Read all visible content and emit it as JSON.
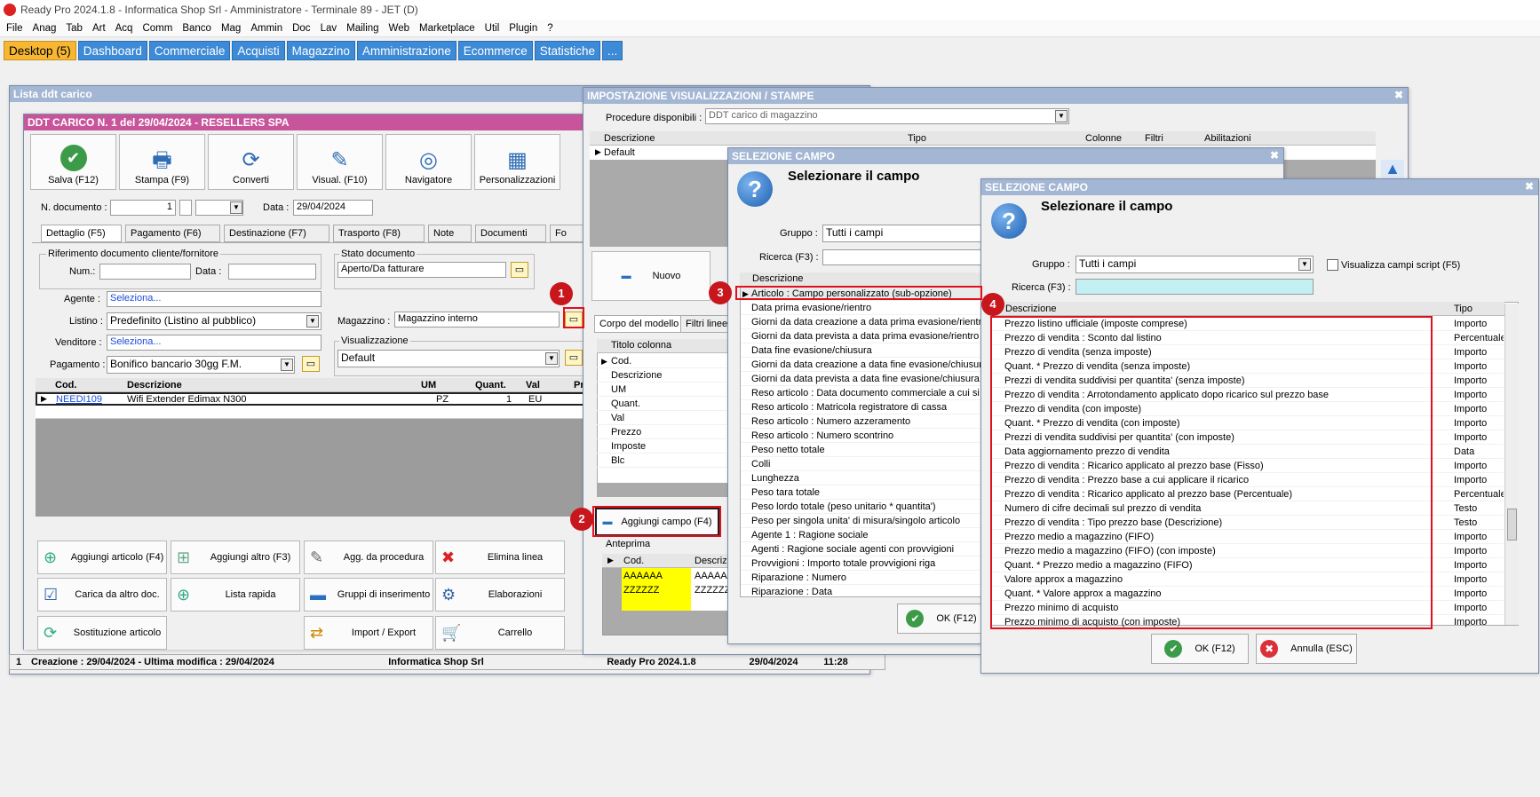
{
  "app": {
    "title": "Ready Pro 2024.1.8 - Informatica Shop Srl - Amministratore - Terminale 89 - JET (D)"
  },
  "menu": [
    "File",
    "Anag",
    "Tab",
    "Art",
    "Acq",
    "Comm",
    "Banco",
    "Mag",
    "Ammin",
    "Doc",
    "Lav",
    "Mailing",
    "Web",
    "Marketplace",
    "Util",
    "Plugin",
    "?"
  ],
  "tabs": [
    "Desktop (5)",
    "Dashboard",
    "Commerciale",
    "Acquisti",
    "Magazzino",
    "Amministrazione",
    "Ecommerce",
    "Statistiche",
    "..."
  ],
  "list_win": {
    "title": "Lista ddt carico"
  },
  "ddt": {
    "title": "DDT CARICO N. 1 del 29/04/2024 - RESELLERS SPA",
    "toolbar": [
      "Salva (F12)",
      "Stampa (F9)",
      "Converti",
      "Visual. (F10)",
      "Navigatore",
      "Personalizzazioni"
    ],
    "ndoc_label": "N. documento :",
    "ndoc": "1",
    "data_label": "Data :",
    "data": "29/04/2024",
    "subtabs": [
      "Dettaglio (F5)",
      "Pagamento (F6)",
      "Destinazione (F7)",
      "Trasporto (F8)",
      "Note",
      "Documenti",
      "Fo"
    ],
    "rif_title": "Riferimento documento cliente/fornitore",
    "num_label": "Num.:",
    "data2_label": "Data :",
    "stato_title": "Stato documento",
    "stato": "Aperto/Da fatturare",
    "agente_label": "Agente :",
    "agente": "Seleziona...",
    "listino_label": "Listino :",
    "listino": "Predefinito (Listino al pubblico)",
    "venditore_label": "Venditore :",
    "venditore": "Seleziona...",
    "pagamento_label": "Pagamento :",
    "pagamento": "Bonifico bancario 30gg F.M.",
    "magazzino_label": "Magazzino :",
    "magazzino": "Magazzino interno",
    "vis_title": "Visualizzazione",
    "vis": "Default",
    "cols": [
      "Cod.",
      "Descrizione",
      "UM",
      "Quant.",
      "Val",
      "Pr"
    ],
    "row": {
      "cod": "NEEDI109",
      "desc": "Wifi Extender Edimax N300",
      "um": "PZ",
      "qty": "1",
      "val": "EU"
    },
    "actions": [
      "Aggiungi articolo (F4)",
      "Aggiungi altro (F3)",
      "Agg. da procedura",
      "Elimina linea",
      "Carica da altro doc.",
      "Lista rapida",
      "Gruppi di inserimento",
      "Elaborazioni",
      "Sostituzione articolo",
      "Import / Export",
      "Carrello"
    ],
    "status": {
      "creazione": "Creazione : 29/04/2024 - Ultima modifica : 29/04/2024",
      "company": "Informatica Shop Srl",
      "version": "Ready Pro 2024.1.8",
      "date": "29/04/2024",
      "time": "11:28"
    }
  },
  "imp": {
    "title": "IMPOSTAZIONE VISUALIZZAZIONI / STAMPE",
    "proc_label": "Procedure disponibili :",
    "proc": "DDT carico di magazzino",
    "cols": [
      "Descrizione",
      "Tipo",
      "Colonne",
      "Filtri",
      "Abilitazioni"
    ],
    "row": "Default",
    "nuovo": "Nuovo",
    "subtabs": [
      "Corpo del modello",
      "Filtri linee"
    ],
    "col_head": "Titolo colonna",
    "col_items": [
      "Cod.",
      "Descrizione",
      "UM",
      "Quant.",
      "Val",
      "Prezzo",
      "Imposte",
      "Blc"
    ],
    "aggiungi": "Aggiungi campo (F4)",
    "anteprima": "Anteprima",
    "prev_cols": [
      "Cod.",
      "Descrizi"
    ],
    "prev_rows": [
      [
        "AAAAAA",
        "AAAAAA"
      ],
      [
        "ZZZZZZ",
        "ZZZZZZ"
      ]
    ]
  },
  "sel1": {
    "title": "SELEZIONE CAMPO",
    "heading": "Selezionare il campo",
    "gruppo_label": "Gruppo :",
    "gruppo": "Tutti i campi",
    "ricerca_label": "Ricerca (F3) :",
    "col": "Descrizione",
    "items": [
      "Articolo : Campo personalizzato (sub-opzione)",
      "Data prima evasione/rientro",
      "Giorni da data creazione a data prima evasione/rientro",
      "Giorni da data prevista a data prima evasione/rientro",
      "Data fine evasione/chiusura",
      "Giorni da data creazione a data fine evasione/chiusura",
      "Giorni da data prevista a data fine evasione/chiusura",
      "Reso articolo : Data documento commerciale a cui si ri",
      "Reso articolo : Matricola registratore di cassa",
      "Reso articolo : Numero azzeramento",
      "Reso articolo : Numero scontrino",
      "Peso netto totale",
      "Colli",
      "Lunghezza",
      "Peso tara totale",
      "Peso lordo totale (peso unitario * quantita')",
      "Peso per singola unita' di misura/singolo articolo",
      "Agente 1 : Ragione sociale",
      "Agenti : Ragione sociale agenti con provvigioni",
      "Provvigioni : Importo totale provvigioni riga",
      "Riparazione : Numero",
      "Riparazione : Data"
    ],
    "ok": "OK (F12)"
  },
  "sel2": {
    "title": "SELEZIONE CAMPO",
    "heading": "Selezionare il campo",
    "gruppo_label": "Gruppo :",
    "gruppo": "Tutti i campi",
    "script_label": "Visualizza campi script (F5)",
    "ricerca_label": "Ricerca (F3) :",
    "ricerca": "",
    "cols": [
      "Descrizione",
      "Tipo"
    ],
    "rows": [
      [
        "Prezzo listino ufficiale (imposte comprese)",
        "Importo"
      ],
      [
        "Prezzo di vendita : Sconto dal listino",
        "Percentuale"
      ],
      [
        "Prezzo di vendita (senza imposte)",
        "Importo"
      ],
      [
        "Quant. * Prezzo di vendita (senza imposte)",
        "Importo"
      ],
      [
        "Prezzi di vendita suddivisi per quantita' (senza imposte)",
        "Importo"
      ],
      [
        "Prezzo di vendita : Arrotondamento applicato dopo ricarico sul prezzo base",
        "Importo"
      ],
      [
        "Prezzo di vendita (con imposte)",
        "Importo"
      ],
      [
        "Quant. * Prezzo di vendita (con imposte)",
        "Importo"
      ],
      [
        "Prezzi di vendita suddivisi per quantita' (con imposte)",
        "Importo"
      ],
      [
        "Data aggiornamento prezzo di vendita",
        "Data"
      ],
      [
        "Prezzo di vendita : Ricarico applicato al prezzo base (Fisso)",
        "Importo"
      ],
      [
        "Prezzo di vendita : Prezzo base a cui applicare il ricarico",
        "Importo"
      ],
      [
        "Prezzo di vendita : Ricarico applicato al prezzo base (Percentuale)",
        "Percentuale"
      ],
      [
        "Numero di cifre decimali sul prezzo di vendita",
        "Testo"
      ],
      [
        "Prezzo di vendita : Tipo prezzo base (Descrizione)",
        "Testo"
      ],
      [
        "Prezzo medio a magazzino (FIFO)",
        "Importo"
      ],
      [
        "Prezzo medio a magazzino (FIFO) (con imposte)",
        "Importo"
      ],
      [
        "Quant. * Prezzo medio a magazzino (FIFO)",
        "Importo"
      ],
      [
        "Valore approx a magazzino",
        "Importo"
      ],
      [
        "Quant. * Valore approx a magazzino",
        "Importo"
      ],
      [
        "Prezzo minimo di acquisto",
        "Importo"
      ],
      [
        "Prezzo minimo di acquisto (con imposte)",
        "Importo"
      ]
    ],
    "ok": "OK (F12)",
    "annulla": "Annulla (ESC)"
  },
  "badges": [
    "1",
    "2",
    "3",
    "4"
  ]
}
